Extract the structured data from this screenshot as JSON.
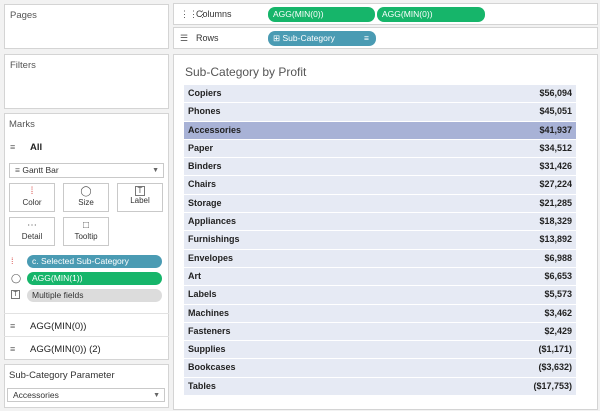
{
  "left": {
    "pages": {
      "title": "Pages"
    },
    "filters": {
      "title": "Filters"
    },
    "marks": {
      "title": "Marks",
      "all_label": "All",
      "mark_type": "Gantt Bar",
      "tiles": [
        {
          "label": "Color",
          "icon": "color-dots-icon"
        },
        {
          "label": "Size",
          "icon": "size-icon"
        },
        {
          "label": "Label",
          "icon": "label-icon"
        },
        {
          "label": "Detail",
          "icon": "detail-icon"
        },
        {
          "label": "Tooltip",
          "icon": "tooltip-icon"
        }
      ],
      "pills": [
        {
          "label": "c. Selected Sub-Category",
          "color": "#4a9bb3"
        },
        {
          "label": "AGG(MIN(1))",
          "color": "#16b56a"
        },
        {
          "label": "Multiple fields",
          "color": "#dcdcdc"
        }
      ],
      "extra_marks": [
        "AGG(MIN(0))",
        "AGG(MIN(0)) (2)"
      ]
    },
    "parameter": {
      "title": "Sub-Category Parameter",
      "value": "Accessories"
    }
  },
  "shelves": {
    "columns": {
      "label": "Columns",
      "pills": [
        "AGG(MIN(0))",
        "AGG(MIN(0))"
      ],
      "pill_color": "#16b56a"
    },
    "rows": {
      "label": "Rows",
      "pill": "Sub-Category",
      "pill_color": "#4a9bb3"
    }
  },
  "sheet": {
    "title": "Sub-Category by Profit",
    "selected": "Accessories",
    "rows": [
      {
        "name": "Copiers",
        "value": "$56,094"
      },
      {
        "name": "Phones",
        "value": "$45,051"
      },
      {
        "name": "Accessories",
        "value": "$41,937"
      },
      {
        "name": "Paper",
        "value": "$34,512"
      },
      {
        "name": "Binders",
        "value": "$31,426"
      },
      {
        "name": "Chairs",
        "value": "$27,224"
      },
      {
        "name": "Storage",
        "value": "$21,285"
      },
      {
        "name": "Appliances",
        "value": "$18,329"
      },
      {
        "name": "Furnishings",
        "value": "$13,892"
      },
      {
        "name": "Envelopes",
        "value": "$6,988"
      },
      {
        "name": "Art",
        "value": "$6,653"
      },
      {
        "name": "Labels",
        "value": "$5,573"
      },
      {
        "name": "Machines",
        "value": "$3,462"
      },
      {
        "name": "Fasteners",
        "value": "$2,429"
      },
      {
        "name": "Supplies",
        "value": "($1,171)"
      },
      {
        "name": "Bookcases",
        "value": "($3,632)"
      },
      {
        "name": "Tables",
        "value": "($17,753)"
      }
    ]
  }
}
